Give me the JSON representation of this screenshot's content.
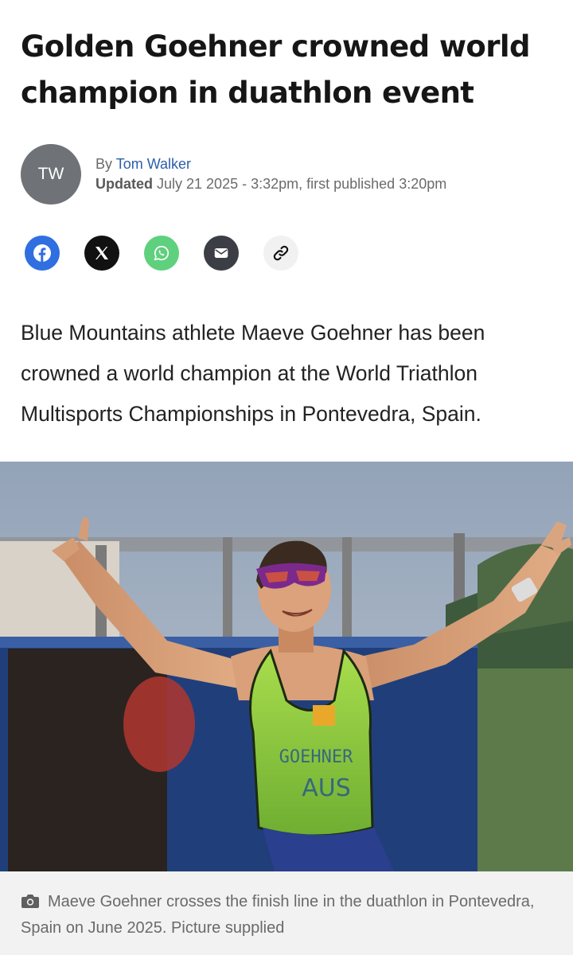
{
  "article": {
    "headline": "Golden Goehner crowned world champion in duathlon event",
    "byline": {
      "avatar_initials": "TW",
      "by_prefix": "By",
      "author": "Tom Walker",
      "updated_label": "Updated",
      "updated_text": "July 21 2025 - 3:32pm, first published 3:20pm"
    },
    "share_buttons": [
      {
        "name": "facebook",
        "icon": "facebook-icon",
        "color": "#2f6fe0"
      },
      {
        "name": "x",
        "icon": "x-logo-icon",
        "color": "#111111"
      },
      {
        "name": "whatsapp",
        "icon": "whatsapp-icon",
        "color": "#5fd07d"
      },
      {
        "name": "email",
        "icon": "mail-icon",
        "color": "#3b3e44"
      },
      {
        "name": "copy-link",
        "icon": "link-icon",
        "color": "#f1f1f1"
      }
    ],
    "lede": "Blue Mountains athlete Maeve Goehner has been crowned a world champion at the World Triathlon Multisports Championships in Pontevedra, Spain.",
    "photo": {
      "jersey_name": "GOEHNER",
      "jersey_country": "AUS"
    },
    "caption": "Maeve Goehner crosses the finish line in the duathlon in Pontevedra, Spain on June 2025. Picture supplied"
  },
  "colors": {
    "author_link": "#2b5fab",
    "avatar_bg": "#6f7377",
    "caption_bg": "#f2f2f2",
    "jersey_green": "#8fce3c"
  }
}
